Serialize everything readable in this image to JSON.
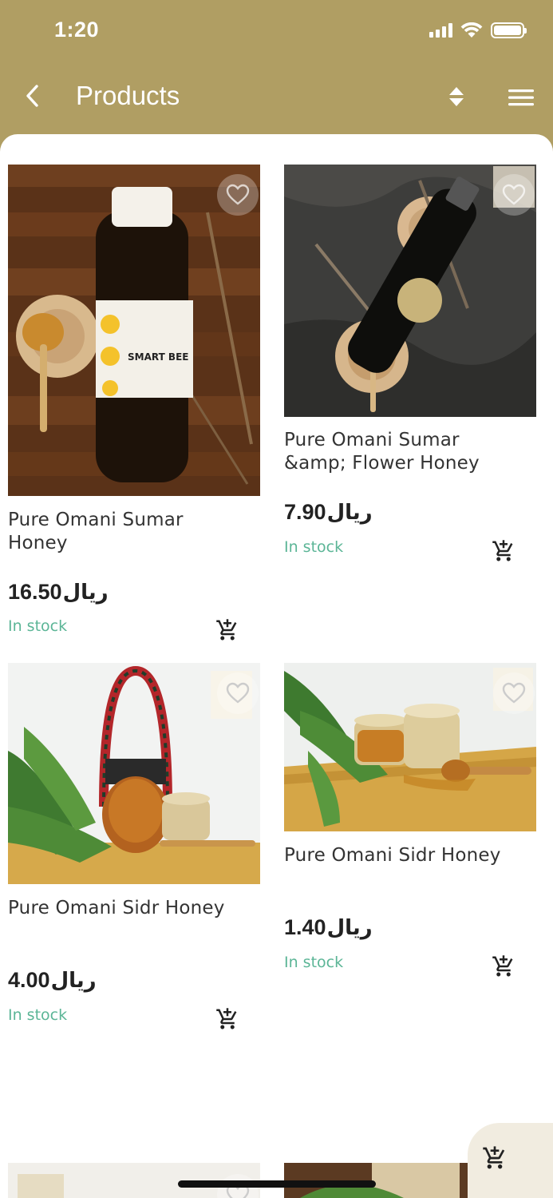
{
  "status_bar": {
    "time": "1:20",
    "icons": [
      "signal-icon",
      "wifi-icon",
      "battery-icon"
    ]
  },
  "header": {
    "title": "Products",
    "back_icon": "chevron-left-icon",
    "sort_icon": "sort-icon",
    "menu_icon": "hamburger-menu-icon"
  },
  "colors": {
    "header_bg": "#b09e63",
    "stock_text": "#5bb596",
    "fab_bg": "#f1ece0"
  },
  "products": [
    {
      "name": "Pure Omani Sumar Honey",
      "price": "16.50",
      "currency": "ریال",
      "stock": "In stock"
    },
    {
      "name": "Pure Omani Sumar &amp; Flower Honey",
      "price": "7.90",
      "currency": "ریال",
      "stock": "In stock"
    },
    {
      "name": "Pure Omani Sidr Honey",
      "price": "4.00",
      "currency": "ریال",
      "stock": "In stock"
    },
    {
      "name": "Pure Omani Sidr Honey",
      "price": "1.40",
      "currency": "ریال",
      "stock": "In stock"
    }
  ],
  "floating_cart_icon": "add-to-cart-icon"
}
